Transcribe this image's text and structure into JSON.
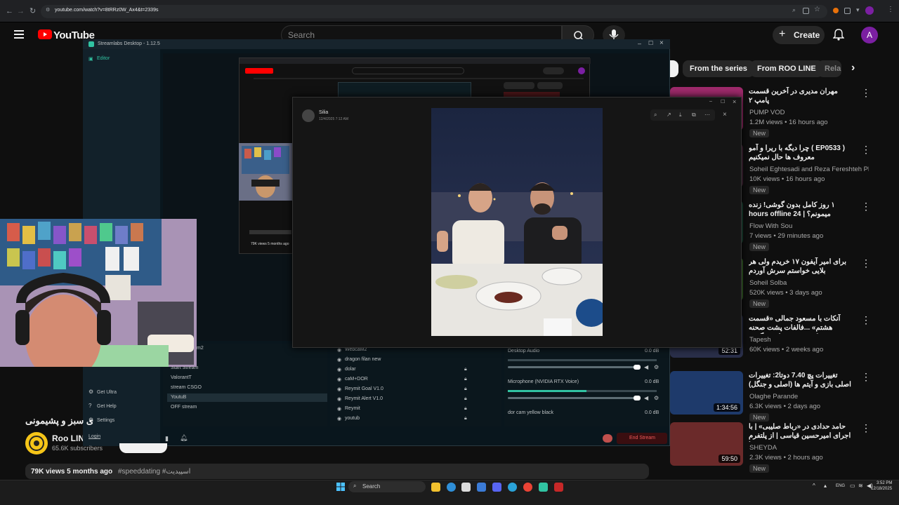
{
  "browser": {
    "url": "youtube.com/watch?v=8tRRz0W_Ax4&t=2339s"
  },
  "youtube": {
    "logo": "YouTube",
    "search_placeholder": "Search",
    "create_label": "Create",
    "avatar_letter": "A",
    "chips": [
      "From the series",
      "From ROO LINE",
      "Rela"
    ],
    "video_title_partial": "ی سبز و پشیمونی",
    "channel_name": "Roo LINE",
    "subscribers": "65.6K subscribers",
    "views_date": "79K views  5 months ago",
    "hashtags": "#speeddating #اسپیدیت"
  },
  "sidebar_videos": [
    {
      "title": "مهران مدیری در آخرین قسمت پامپ ۲",
      "channel": "PUMP VOD",
      "meta": "1.2M views • 16 hours ago",
      "badge": "New",
      "duration": ""
    },
    {
      "title": "( EP0533 ) چرا دیگه با ریرا و آمو معروف ها حال نمیکنیم",
      "channel": "Soheil Eghtesadi and Reza Fereshteh Pl...",
      "meta": "10K views • 16 hours ago",
      "badge": "New",
      "duration": ""
    },
    {
      "title": "۱ روز کامل بدون گوشی! زنده میمونم؟ | hours offline 24",
      "channel": "Flow With Sou",
      "meta": "7 views • 29 minutes ago",
      "badge": "New",
      "duration": ""
    },
    {
      "title": "برای امیر آیفون ۱۷ خریدم ولی هر بلایی خواستم سرش آوردم",
      "channel": "Soheil Solba",
      "meta": "520K views • 3 days ago",
      "badge": "New",
      "duration": ""
    },
    {
      "title": "آنکات با مسعود جمالی «قسمت هشتم» ...فالفات پشت صحنه کنسرت شهرام، درگیری",
      "channel": "Tapesh",
      "meta": "60K views • 2 weeks ago",
      "badge": "",
      "duration": "52:31"
    },
    {
      "title": "تغییرات پچ 7.40 دوتا2: تغییرات اصلی بازی و آیتم ها (اصلی و جنگل)",
      "channel": "Olaghe Parande",
      "meta": "6.3K views • 2 days ago",
      "badge": "New",
      "duration": "1:34:56"
    },
    {
      "title": "حامد حدادی در «رباط صلیبی» | با اجرای امیرحسین قیاسی | از پلتفرم شیدا",
      "channel": "SHEYDA",
      "meta": "2.3K views • 2 hours ago",
      "badge": "New",
      "duration": "59:50"
    }
  ],
  "streamlabs": {
    "title": "Streamlabs Desktop - 1.12.5",
    "editor": "Editor",
    "get_ultra": "Get Ultra",
    "get_help": "Get Help",
    "settings": "Settings",
    "login": "Login",
    "scenes": [
      "Start Stream",
      "ValorantT",
      "stream CSGO",
      "YoutuB",
      "OFF stream"
    ],
    "scene_partial": "m2",
    "sources": [
      "WebcaM2",
      "dragon filan new",
      "dolar",
      "caM+DOR",
      "Reymit Goal V1.0",
      "Reymit Alert V1.0",
      "Reymit",
      "youtub"
    ],
    "mixer": [
      {
        "name": "Desktop Audio",
        "level": "0.0 dB"
      },
      {
        "name": "Microphone (NVIDIA RTX Voice)",
        "level": "0.0 dB"
      },
      {
        "name": "dor cam yellow black",
        "level": "0.0 dB"
      }
    ],
    "end_stream": "End Stream"
  },
  "viewer": {
    "sender": "Silia",
    "timestamp": "12/4/2025 7:12 AM"
  },
  "inner_window": {
    "views": "79K views  5 months ago"
  },
  "taskbar": {
    "search": "Search",
    "lang": "ENG",
    "time": "3:52 PM",
    "date": "12/18/2025"
  }
}
